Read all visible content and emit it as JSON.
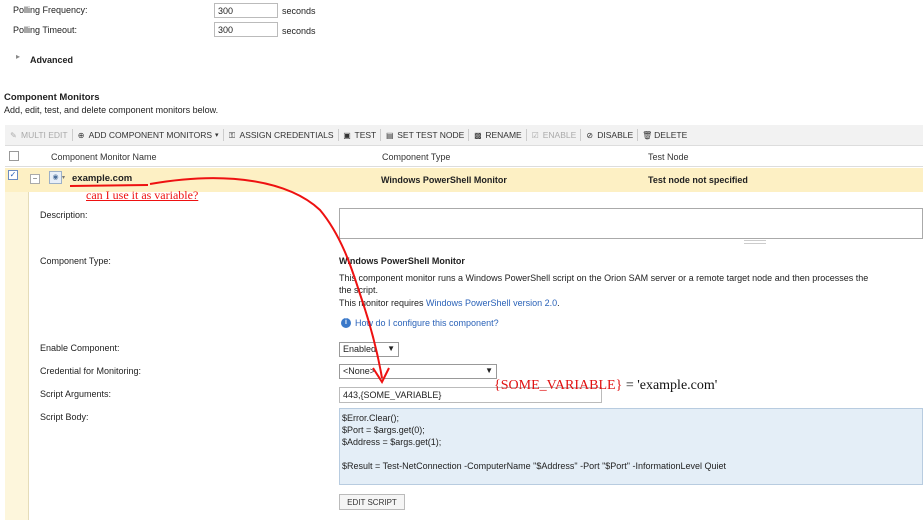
{
  "settings": {
    "polling_frequency_label": "Polling Frequency:",
    "polling_frequency_value": "300",
    "polling_timeout_label": "Polling Timeout:",
    "polling_timeout_value": "300",
    "unit": "seconds",
    "advanced_label": "Advanced"
  },
  "component_monitors": {
    "title": "Component Monitors",
    "subtitle": "Add, edit, test, and delete component monitors below."
  },
  "toolbar": {
    "multi_edit": "MULTI EDIT",
    "add_component_monitors": "ADD COMPONENT MONITORS",
    "assign_credentials": "ASSIGN CREDENTIALS",
    "test": "TEST",
    "set_test_node": "SET TEST NODE",
    "rename": "RENAME",
    "enable": "ENABLE",
    "disable": "DISABLE",
    "delete": "DELETE"
  },
  "table": {
    "columns": [
      "Component Monitor Name",
      "Component Type",
      "Test Node"
    ],
    "row": {
      "name": "example.com",
      "type": "Windows PowerShell Monitor",
      "test_node": "Test node not specified"
    }
  },
  "details": {
    "description_label": "Description:",
    "description_value": "",
    "component_type_label": "Component Type:",
    "component_type_title": "Windows PowerShell Monitor",
    "component_type_desc": "This component monitor runs a Windows PowerShell script on the Orion SAM server or a remote target node and then processes the",
    "component_type_desc2": "the script.",
    "requires_prefix": "This monitor requires ",
    "requires_link": "Windows PowerShell version 2.0",
    "requires_suffix": ".",
    "help_link": "How do I configure this component?",
    "enable_label": "Enable Component:",
    "enable_value": "Enabled",
    "credential_label": "Credential for Monitoring:",
    "credential_value": "<None>",
    "script_args_label": "Script Arguments:",
    "script_args_value": "443,{SOME_VARIABLE}",
    "script_body_label": "Script Body:",
    "script_lines": [
      "$Error.Clear();",
      "$Port = $args.get(0);",
      "$Address = $args.get(1);",
      "",
      "$Result = Test-NetConnection -ComputerName \"$Address\" -Port \"$Port\" -InformationLevel Quiet"
    ],
    "edit_script": "EDIT SCRIPT"
  },
  "annotations": {
    "question": "can I use it as variable?",
    "equation": "{SOME_VARIABLE} = 'example.com'",
    "color": "#e11111"
  }
}
